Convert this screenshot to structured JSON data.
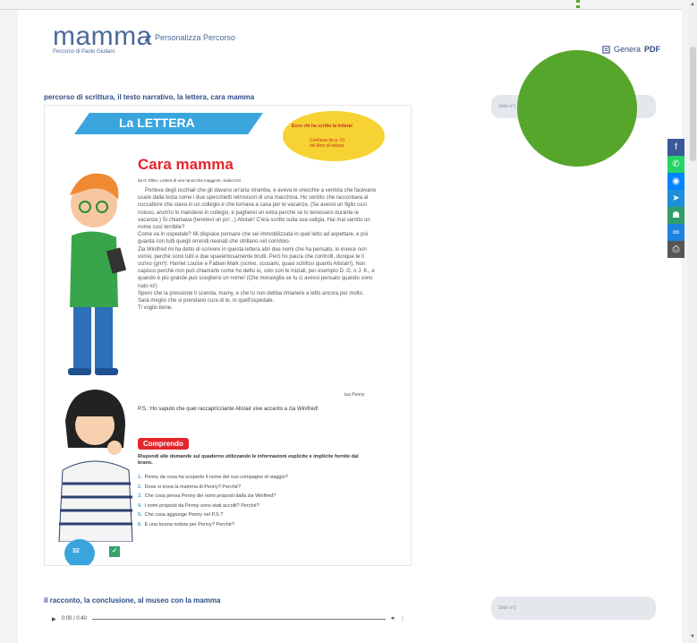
{
  "header": {
    "title": "mamma",
    "edit_label": "Personalizza Percorso",
    "author": "Percorso di Paolo Giuliani",
    "pdf_prefix": "Genera",
    "pdf_bold": "PDF"
  },
  "section1": {
    "heading": "percorso di scrittura, il testo narrativo, la lettera, cara mamma",
    "slide_label": "Slide nº1"
  },
  "book": {
    "banner": "La LETTERA",
    "sticker_top": "Ecco chi ha scritto la lettera!",
    "sticker_line1": "Continua da p. 91",
    "sticker_line2": "del libro di lettura.",
    "title": "Cara mamma",
    "byline": "da N. Ellen, Lettera di una ranocchia maggiore, Salani Ed.",
    "paragraphs": [
      "Porteva degli occhiali che gli davano un'aria stramba, e aveva le orecchie a ventola che facevano usare dalla testa come i due specchietti retrovisori di una macchina. Ho sentito che raccontava al cuccattore che stava in un collegio e che tornava a casa per le vacanze. (Se avessi un figlio così noioso, anch'io lo manderei in collegio, e pagherei un extra perché se lo tenessero durante le vacanze.) Si chiamava (tenetevi un po'...) Alistair! C'era scritto sulla sua valigia. Hai mai sentito un nome così terribile?",
      "Come va in ospedale? Mi dispiace pensare che sei immobilizzata in quel letto ad aspettare, e poi guarda con tutti quegli orrendi neonati che strillano nel corridoio.",
      "Zia Winifred mi ha detto di scrivere in questa lettera altri due nomi che ha pensato, io invece non vorrei, perché sono tutti e due spaventosamente brutti. Però ho paura che controlli, dunque te li scrivo (grrr!): Harriet Louise e Fabian Mark (scrivo, scusami, quasi schifosi quanto Alistair!). Non capisco perché non può chiamarlo come ho detto io, solo con le iniziali, per esempio D. G. o J. K., e quando è più grande può scegliersi un nome! (Che meraviglia se tu ci avessi pensato quando sono nato io!)",
      "Spero che la pressione ti scenda, mamy, e che tu non debba rimanere a letto ancora per molto.",
      "Sarà meglio che si prendano cura di te, in quell'ospedale.",
      "Ti voglio bene,"
    ],
    "signature": "tua Penny",
    "ps": "P.S.: Ho saputo che quel raccapricciante Alistair vive accanto a zia Winifred!",
    "comprendo": "Comprendo",
    "questions_intro": "Rispondi alle domande sul quaderno utilizzando le informazioni esplicite e implicite fornite dal brano.",
    "questions": [
      {
        "n": "1.",
        "text": "Penny da cosa ha scoperto il nome del suo compagno di viaggio?"
      },
      {
        "n": "2.",
        "text": "Dove si trova la mamma di Penny? Perché?"
      },
      {
        "n": "3.",
        "text": "Che cosa pensa Penny dei nomi proposti dalla zia Winifred?"
      },
      {
        "n": "4.",
        "text": "I nomi proposti da Penny sono stati accolti? Perché?"
      },
      {
        "n": "5.",
        "text": "Che cosa aggiunge Penny nel P.S.?"
      },
      {
        "n": "6.",
        "text": "È una buona notizia per Penny? Perché?"
      }
    ],
    "page_number": "32"
  },
  "section2": {
    "heading": "il racconto, la conclusione, al museo con la mamma",
    "slide_label": "Slide nº2"
  },
  "audio": {
    "time": "0:00 / 0:40"
  },
  "share": {
    "colors": [
      "#3b5998",
      "#25d366",
      "#0084ff",
      "#1f8ed8",
      "#2f9e6b",
      "#1c82e0",
      "#555555"
    ],
    "icons": [
      "facebook-icon",
      "whatsapp-icon",
      "messenger-icon",
      "telegram-icon",
      "classroom-icon",
      "link-icon",
      "print-icon"
    ]
  },
  "colors": {
    "accent": "#2f4d85",
    "circle": "#57a62c"
  }
}
